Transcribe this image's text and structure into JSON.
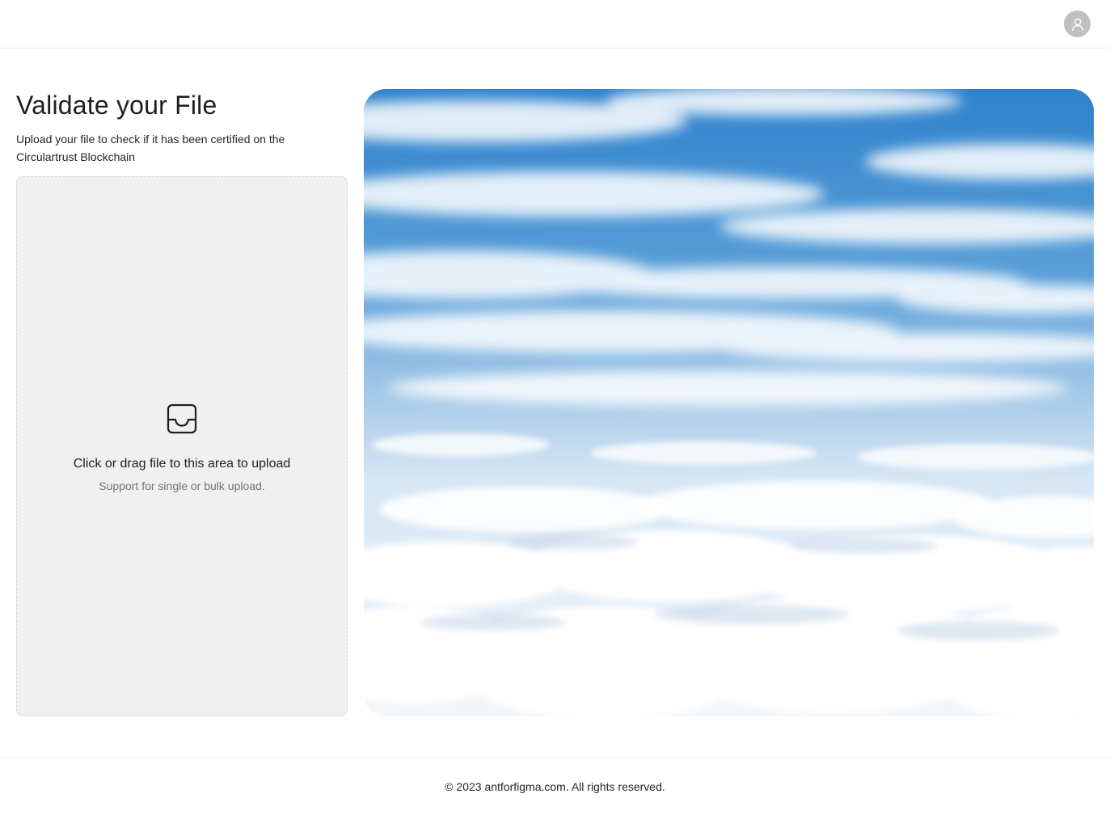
{
  "header": {
    "avatar_icon": "user-icon"
  },
  "main": {
    "title": "Validate your File",
    "description": "Upload your file to check if it has been certified on the Circulartrust Blockchain",
    "upload": {
      "icon": "inbox-icon",
      "text": "Click or drag file to this area to upload",
      "hint": "Support for single or bulk upload."
    },
    "hero_image": "sky-clouds-photo"
  },
  "footer": {
    "copyright": "© 2023 antforfigma.com. All rights reserved."
  },
  "colors": {
    "dropzone_bg": "#f0f0f0",
    "avatar_bg": "#bfbfbf",
    "sky_blue": "#3f8fd3"
  }
}
